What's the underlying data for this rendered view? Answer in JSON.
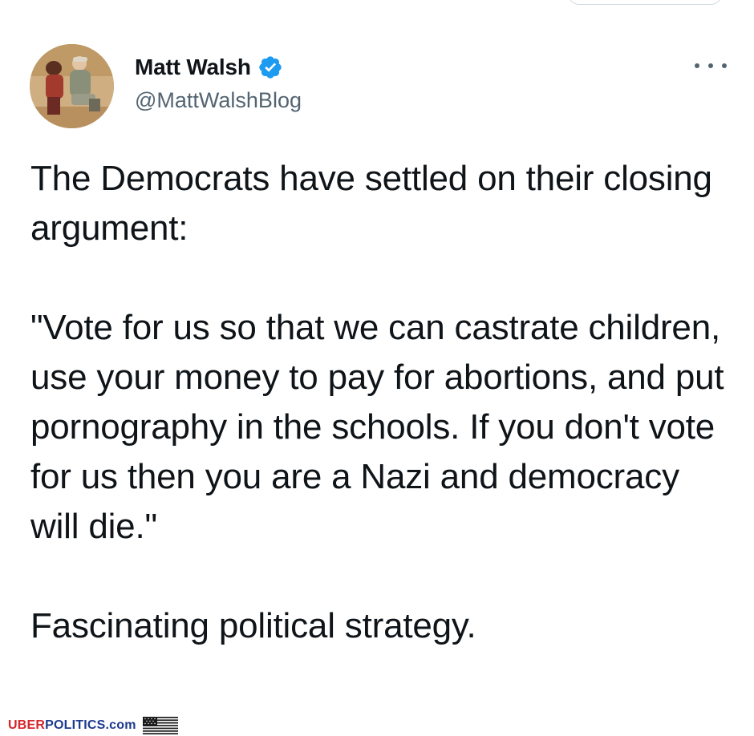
{
  "tweet": {
    "author": {
      "display_name": "Matt Walsh",
      "handle": "@MattWalshBlog",
      "verified": true
    },
    "text": {
      "para1": "The Democrats have settled on their closing argument:",
      "para2": "\"Vote for us so that we can castrate children, use your money to pay for abortions, and put pornography in the schools. If you don't vote for us then you are a Nazi and democracy will die.\"",
      "para3": "Fascinating political strategy."
    }
  },
  "watermark": {
    "red_part": "UBER",
    "blue_part": "POLITICS.com"
  },
  "icons": {
    "verified": "verified-badge-icon",
    "more": "more-options-icon",
    "flag": "us-flag-icon"
  },
  "colors": {
    "verified_blue": "#1d9bf0",
    "secondary_text": "#536471",
    "watermark_red": "#d4262c",
    "watermark_blue": "#1d3b8f"
  }
}
